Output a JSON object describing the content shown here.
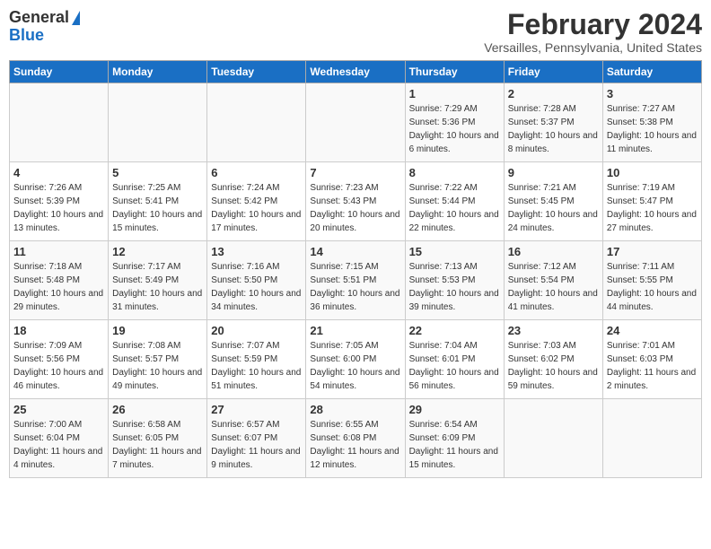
{
  "header": {
    "logo_general": "General",
    "logo_blue": "Blue",
    "month_title": "February 2024",
    "location": "Versailles, Pennsylvania, United States"
  },
  "days_of_week": [
    "Sunday",
    "Monday",
    "Tuesday",
    "Wednesday",
    "Thursday",
    "Friday",
    "Saturday"
  ],
  "weeks": [
    [
      {
        "day": "",
        "sunrise": "",
        "sunset": "",
        "daylight": ""
      },
      {
        "day": "",
        "sunrise": "",
        "sunset": "",
        "daylight": ""
      },
      {
        "day": "",
        "sunrise": "",
        "sunset": "",
        "daylight": ""
      },
      {
        "day": "",
        "sunrise": "",
        "sunset": "",
        "daylight": ""
      },
      {
        "day": "1",
        "sunrise": "Sunrise: 7:29 AM",
        "sunset": "Sunset: 5:36 PM",
        "daylight": "Daylight: 10 hours and 6 minutes."
      },
      {
        "day": "2",
        "sunrise": "Sunrise: 7:28 AM",
        "sunset": "Sunset: 5:37 PM",
        "daylight": "Daylight: 10 hours and 8 minutes."
      },
      {
        "day": "3",
        "sunrise": "Sunrise: 7:27 AM",
        "sunset": "Sunset: 5:38 PM",
        "daylight": "Daylight: 10 hours and 11 minutes."
      }
    ],
    [
      {
        "day": "4",
        "sunrise": "Sunrise: 7:26 AM",
        "sunset": "Sunset: 5:39 PM",
        "daylight": "Daylight: 10 hours and 13 minutes."
      },
      {
        "day": "5",
        "sunrise": "Sunrise: 7:25 AM",
        "sunset": "Sunset: 5:41 PM",
        "daylight": "Daylight: 10 hours and 15 minutes."
      },
      {
        "day": "6",
        "sunrise": "Sunrise: 7:24 AM",
        "sunset": "Sunset: 5:42 PM",
        "daylight": "Daylight: 10 hours and 17 minutes."
      },
      {
        "day": "7",
        "sunrise": "Sunrise: 7:23 AM",
        "sunset": "Sunset: 5:43 PM",
        "daylight": "Daylight: 10 hours and 20 minutes."
      },
      {
        "day": "8",
        "sunrise": "Sunrise: 7:22 AM",
        "sunset": "Sunset: 5:44 PM",
        "daylight": "Daylight: 10 hours and 22 minutes."
      },
      {
        "day": "9",
        "sunrise": "Sunrise: 7:21 AM",
        "sunset": "Sunset: 5:45 PM",
        "daylight": "Daylight: 10 hours and 24 minutes."
      },
      {
        "day": "10",
        "sunrise": "Sunrise: 7:19 AM",
        "sunset": "Sunset: 5:47 PM",
        "daylight": "Daylight: 10 hours and 27 minutes."
      }
    ],
    [
      {
        "day": "11",
        "sunrise": "Sunrise: 7:18 AM",
        "sunset": "Sunset: 5:48 PM",
        "daylight": "Daylight: 10 hours and 29 minutes."
      },
      {
        "day": "12",
        "sunrise": "Sunrise: 7:17 AM",
        "sunset": "Sunset: 5:49 PM",
        "daylight": "Daylight: 10 hours and 31 minutes."
      },
      {
        "day": "13",
        "sunrise": "Sunrise: 7:16 AM",
        "sunset": "Sunset: 5:50 PM",
        "daylight": "Daylight: 10 hours and 34 minutes."
      },
      {
        "day": "14",
        "sunrise": "Sunrise: 7:15 AM",
        "sunset": "Sunset: 5:51 PM",
        "daylight": "Daylight: 10 hours and 36 minutes."
      },
      {
        "day": "15",
        "sunrise": "Sunrise: 7:13 AM",
        "sunset": "Sunset: 5:53 PM",
        "daylight": "Daylight: 10 hours and 39 minutes."
      },
      {
        "day": "16",
        "sunrise": "Sunrise: 7:12 AM",
        "sunset": "Sunset: 5:54 PM",
        "daylight": "Daylight: 10 hours and 41 minutes."
      },
      {
        "day": "17",
        "sunrise": "Sunrise: 7:11 AM",
        "sunset": "Sunset: 5:55 PM",
        "daylight": "Daylight: 10 hours and 44 minutes."
      }
    ],
    [
      {
        "day": "18",
        "sunrise": "Sunrise: 7:09 AM",
        "sunset": "Sunset: 5:56 PM",
        "daylight": "Daylight: 10 hours and 46 minutes."
      },
      {
        "day": "19",
        "sunrise": "Sunrise: 7:08 AM",
        "sunset": "Sunset: 5:57 PM",
        "daylight": "Daylight: 10 hours and 49 minutes."
      },
      {
        "day": "20",
        "sunrise": "Sunrise: 7:07 AM",
        "sunset": "Sunset: 5:59 PM",
        "daylight": "Daylight: 10 hours and 51 minutes."
      },
      {
        "day": "21",
        "sunrise": "Sunrise: 7:05 AM",
        "sunset": "Sunset: 6:00 PM",
        "daylight": "Daylight: 10 hours and 54 minutes."
      },
      {
        "day": "22",
        "sunrise": "Sunrise: 7:04 AM",
        "sunset": "Sunset: 6:01 PM",
        "daylight": "Daylight: 10 hours and 56 minutes."
      },
      {
        "day": "23",
        "sunrise": "Sunrise: 7:03 AM",
        "sunset": "Sunset: 6:02 PM",
        "daylight": "Daylight: 10 hours and 59 minutes."
      },
      {
        "day": "24",
        "sunrise": "Sunrise: 7:01 AM",
        "sunset": "Sunset: 6:03 PM",
        "daylight": "Daylight: 11 hours and 2 minutes."
      }
    ],
    [
      {
        "day": "25",
        "sunrise": "Sunrise: 7:00 AM",
        "sunset": "Sunset: 6:04 PM",
        "daylight": "Daylight: 11 hours and 4 minutes."
      },
      {
        "day": "26",
        "sunrise": "Sunrise: 6:58 AM",
        "sunset": "Sunset: 6:05 PM",
        "daylight": "Daylight: 11 hours and 7 minutes."
      },
      {
        "day": "27",
        "sunrise": "Sunrise: 6:57 AM",
        "sunset": "Sunset: 6:07 PM",
        "daylight": "Daylight: 11 hours and 9 minutes."
      },
      {
        "day": "28",
        "sunrise": "Sunrise: 6:55 AM",
        "sunset": "Sunset: 6:08 PM",
        "daylight": "Daylight: 11 hours and 12 minutes."
      },
      {
        "day": "29",
        "sunrise": "Sunrise: 6:54 AM",
        "sunset": "Sunset: 6:09 PM",
        "daylight": "Daylight: 11 hours and 15 minutes."
      },
      {
        "day": "",
        "sunrise": "",
        "sunset": "",
        "daylight": ""
      },
      {
        "day": "",
        "sunrise": "",
        "sunset": "",
        "daylight": ""
      }
    ]
  ]
}
